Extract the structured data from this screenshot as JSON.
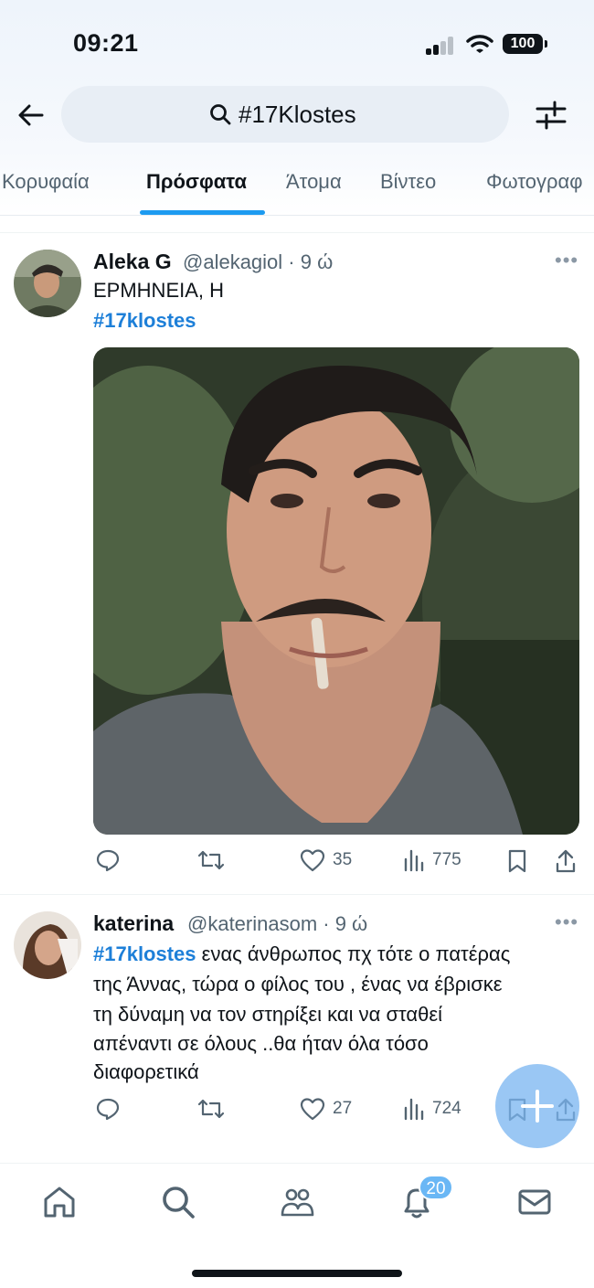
{
  "status_bar": {
    "time": "09:21",
    "battery": "100"
  },
  "search": {
    "query": "#17Klostes"
  },
  "tabs": [
    {
      "label": "Κορυφαία"
    },
    {
      "label": "Πρόσφατα"
    },
    {
      "label": "Άτομα"
    },
    {
      "label": "Βίντεο"
    },
    {
      "label": "Φωτογραφ"
    }
  ],
  "posts": [
    {
      "name": "Aleka G",
      "meta": "@alekagiol · 9 ώ",
      "text_line1": "ΕΡΜΗΝΕΙΑ, Η",
      "hashtag": "#17klostes",
      "likes": "35",
      "views": "775"
    },
    {
      "name": "katerina",
      "meta": "@katerinasom · 9 ώ",
      "hashtag": "#17klostes",
      "text_line1": " ενας άνθρωπος πχ τότε ο πατέρας",
      "text_line2": "της Άννας, τώρα ο φίλος του , ένας να έβρισκε",
      "text_line3": "τη δύναμη να τον στηρίξει και να σταθεί",
      "text_line4": "απέναντι σε όλους ..θα ήταν όλα τόσο",
      "text_line5": "διαφορετικά",
      "likes": "27",
      "views": "724"
    }
  ],
  "nav": {
    "notifications_badge": "20"
  },
  "colors": {
    "accent": "#1d9bf0",
    "hashtag": "#1d7fd8",
    "muted": "#536471"
  }
}
